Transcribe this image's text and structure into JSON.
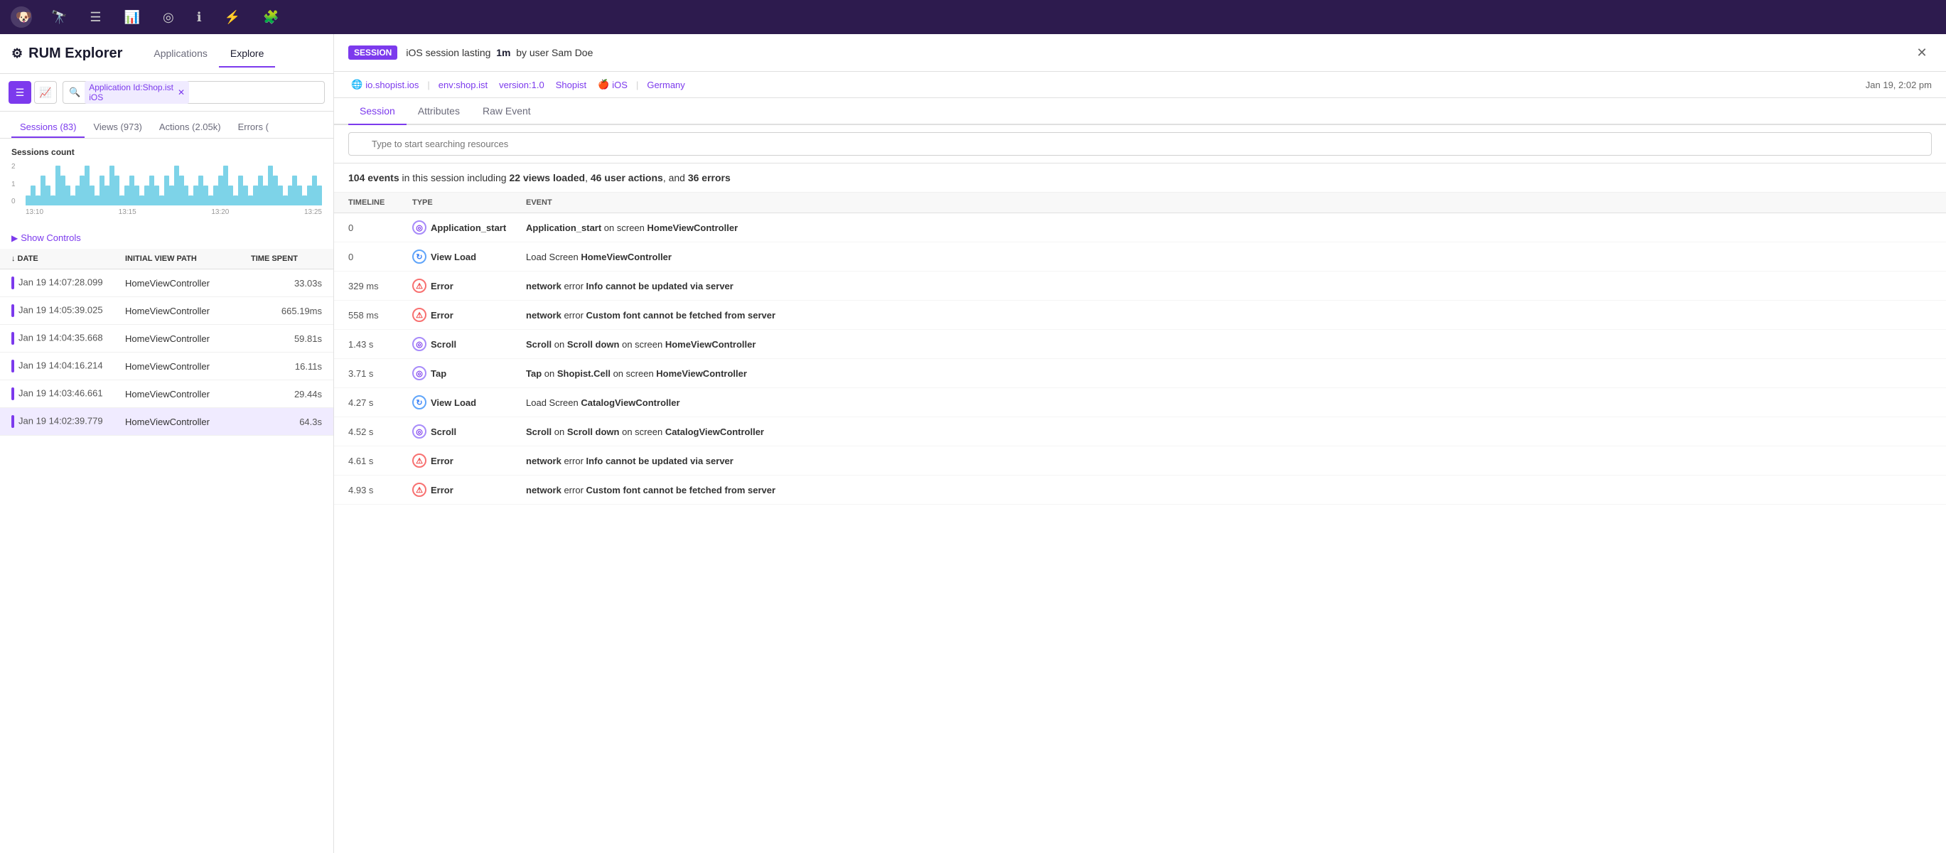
{
  "topNav": {
    "icons": [
      "binoculars",
      "list",
      "bar-chart",
      "network",
      "info",
      "lightning",
      "puzzle"
    ]
  },
  "leftPanel": {
    "title": "RUM Explorer",
    "tabs": [
      {
        "label": "Applications",
        "active": false
      },
      {
        "label": "Explore",
        "active": true
      }
    ],
    "search": {
      "filterTag": "Application Id:Shop.ist iOS",
      "placeholder": ""
    },
    "subTabs": [
      {
        "label": "Sessions (83)",
        "active": true
      },
      {
        "label": "Views (973)",
        "active": false
      },
      {
        "label": "Actions (2.05k)",
        "active": false
      },
      {
        "label": "Errors (",
        "active": false
      }
    ],
    "chart": {
      "title": "Sessions count",
      "yLabels": [
        "2",
        "1",
        "0"
      ],
      "xLabels": [
        "13:10",
        "13:15",
        "13:20",
        "13:25"
      ],
      "bars": [
        1,
        2,
        1,
        3,
        2,
        1,
        4,
        3,
        2,
        1,
        2,
        3,
        4,
        2,
        1,
        3,
        2,
        4,
        3,
        1,
        2,
        3,
        2,
        1,
        2,
        3,
        2,
        1,
        3,
        2,
        4,
        3,
        2,
        1,
        2,
        3,
        2,
        1,
        2,
        3,
        4,
        2,
        1,
        3,
        2,
        1,
        2,
        3,
        2,
        4,
        3,
        2,
        1,
        2,
        3,
        2,
        1,
        2,
        3,
        2
      ]
    },
    "showControls": "Show Controls",
    "tableHeaders": [
      {
        "label": "↓ DATE",
        "key": "date"
      },
      {
        "label": "INITIAL VIEW PATH",
        "key": "path"
      },
      {
        "label": "TIME SPENT",
        "key": "timeSpent"
      }
    ],
    "rows": [
      {
        "date": "Jan 19 14:07:28.099",
        "path": "HomeViewController",
        "timeSpent": "33.03s",
        "selected": false
      },
      {
        "date": "Jan 19 14:05:39.025",
        "path": "HomeViewController",
        "timeSpent": "665.19ms",
        "selected": false
      },
      {
        "date": "Jan 19 14:04:35.668",
        "path": "HomeViewController",
        "timeSpent": "59.81s",
        "selected": false
      },
      {
        "date": "Jan 19 14:04:16.214",
        "path": "HomeViewController",
        "timeSpent": "16.11s",
        "selected": false
      },
      {
        "date": "Jan 19 14:03:46.661",
        "path": "HomeViewController",
        "timeSpent": "29.44s",
        "selected": false
      },
      {
        "date": "Jan 19 14:02:39.779",
        "path": "HomeViewController",
        "timeSpent": "64.3s",
        "selected": true
      }
    ]
  },
  "rightPanel": {
    "sessionBadge": "SESSION",
    "sessionTitle": "iOS session lasting",
    "sessionDuration": "1m",
    "sessionBy": "by user Sam Doe",
    "metaTags": [
      {
        "label": "io.shopist.ios",
        "icon": "globe"
      },
      {
        "label": "env:shop.ist",
        "icon": null
      },
      {
        "label": "version:1.0",
        "icon": null
      },
      {
        "label": "Shopist",
        "icon": null
      },
      {
        "label": "iOS",
        "icon": "apple"
      },
      {
        "label": "Germany",
        "icon": null
      }
    ],
    "timestamp": "Jan 19, 2:02 pm",
    "tabs": [
      {
        "label": "Session",
        "active": true
      },
      {
        "label": "Attributes",
        "active": false
      },
      {
        "label": "Raw Event",
        "active": false
      }
    ],
    "searchPlaceholder": "Type to start searching resources",
    "eventsSummary": {
      "prefix": "104 events",
      "middle": " in this session including ",
      "views": "22 views loaded",
      "comma1": ", ",
      "actions": "46 user actions",
      "and": ", and ",
      "errors": "36 errors"
    },
    "tableHeaders": [
      {
        "label": "TIMELINE"
      },
      {
        "label": "TYPE"
      },
      {
        "label": "EVENT"
      }
    ],
    "events": [
      {
        "timeline": "0",
        "typeIcon": "action",
        "typeLabel": "Application_start",
        "eventDesc": "Application_start on screen HomeViewController",
        "eventBolds": [
          "Application_start",
          "HomeViewController"
        ]
      },
      {
        "timeline": "0",
        "typeIcon": "view",
        "typeLabel": "View Load",
        "eventDesc": "Load Screen HomeViewController",
        "eventBolds": [
          "HomeViewController"
        ]
      },
      {
        "timeline": "329 ms",
        "typeIcon": "error",
        "typeLabel": "Error",
        "eventDesc": "network error Info cannot be updated via server",
        "eventBolds": [
          "network",
          "Info cannot be updated via server"
        ]
      },
      {
        "timeline": "558 ms",
        "typeIcon": "error",
        "typeLabel": "Error",
        "eventDesc": "network error Custom font cannot be fetched from server",
        "eventBolds": [
          "network",
          "Custom font cannot be fetched from server"
        ]
      },
      {
        "timeline": "1.43 s",
        "typeIcon": "action",
        "typeLabel": "Scroll",
        "eventDesc": "Scroll on Scroll down on screen HomeViewController",
        "eventBolds": [
          "Scroll",
          "Scroll down",
          "HomeViewController"
        ]
      },
      {
        "timeline": "3.71 s",
        "typeIcon": "action",
        "typeLabel": "Tap",
        "eventDesc": "Tap on Shopist.Cell on screen HomeViewController",
        "eventBolds": [
          "Tap",
          "Shopist.Cell",
          "HomeViewController"
        ]
      },
      {
        "timeline": "4.27 s",
        "typeIcon": "view",
        "typeLabel": "View Load",
        "eventDesc": "Load Screen CatalogViewController",
        "eventBolds": [
          "CatalogViewController"
        ]
      },
      {
        "timeline": "4.52 s",
        "typeIcon": "action",
        "typeLabel": "Scroll",
        "eventDesc": "Scroll on Scroll down on screen CatalogViewController",
        "eventBolds": [
          "Scroll",
          "Scroll down",
          "CatalogViewController"
        ]
      },
      {
        "timeline": "4.61 s",
        "typeIcon": "error",
        "typeLabel": "Error",
        "eventDesc": "network error Info cannot be updated via server",
        "eventBolds": [
          "network",
          "Info cannot be updated via server"
        ]
      },
      {
        "timeline": "4.93 s",
        "typeIcon": "error",
        "typeLabel": "Error",
        "eventDesc": "network error Custom font cannot be fetched from server",
        "eventBolds": [
          "network",
          "Custom font cannot be fetched from server"
        ]
      }
    ]
  }
}
